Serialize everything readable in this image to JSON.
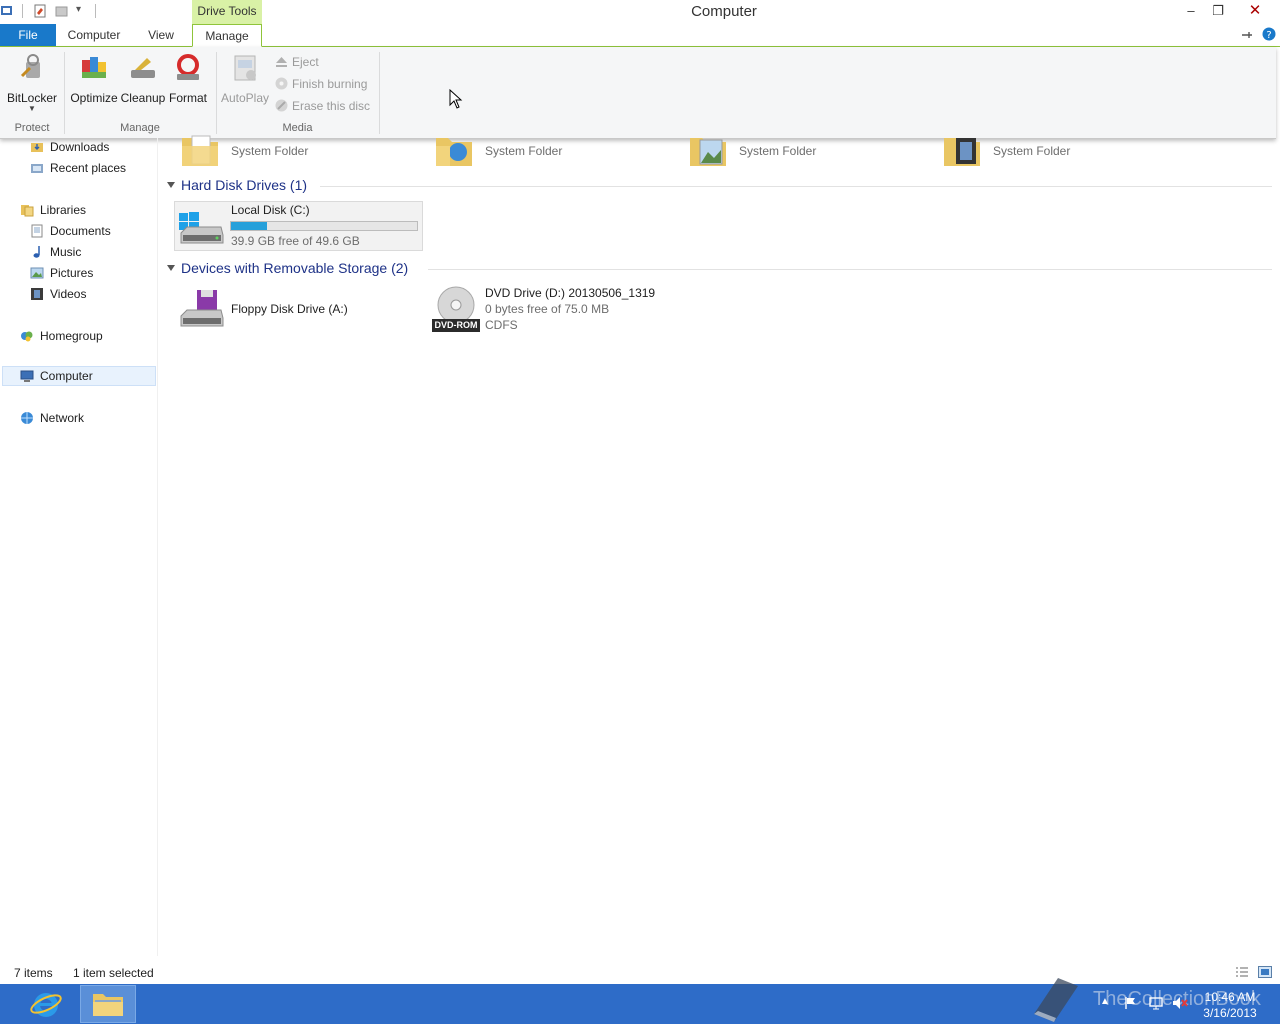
{
  "window": {
    "title": "Computer",
    "context_tab": "Drive Tools",
    "controls": {
      "minimize": "–",
      "restore": "❐",
      "close": "✕"
    }
  },
  "tabs": [
    {
      "label": "File"
    },
    {
      "label": "Computer"
    },
    {
      "label": "View"
    },
    {
      "label": "Manage"
    }
  ],
  "ribbon": {
    "protect": {
      "bitlocker": "BitLocker",
      "label": "Protect"
    },
    "manage": {
      "optimize": "Optimize",
      "cleanup": "Cleanup",
      "format": "Format",
      "label": "Manage"
    },
    "media": {
      "autoplay": "AutoPlay",
      "eject": "Eject",
      "finish_burning": "Finish burning",
      "erase_disc": "Erase this disc",
      "label": "Media"
    }
  },
  "nav": {
    "downloads": "Downloads",
    "recent": "Recent places",
    "libraries": "Libraries",
    "documents": "Documents",
    "music": "Music",
    "pictures": "Pictures",
    "videos": "Videos",
    "homegroup": "Homegroup",
    "computer": "Computer",
    "network": "Network"
  },
  "folders": [
    {
      "sub": "System Folder"
    },
    {
      "sub": "System Folder"
    },
    {
      "sub": "System Folder"
    },
    {
      "sub": "System Folder"
    }
  ],
  "groups": {
    "hdd": "Hard Disk Drives (1)",
    "removable": "Devices with Removable Storage (2)"
  },
  "drives": {
    "c": {
      "name": "Local Disk (C:)",
      "free": "39.9 GB free of 49.6 GB",
      "used_fraction": 0.196
    },
    "a": {
      "name": "Floppy Disk Drive (A:)"
    },
    "d": {
      "name": "DVD Drive (D:) 20130506_1319",
      "free": "0 bytes free of 75.0 MB",
      "fs": "CDFS",
      "badge": "DVD-ROM"
    }
  },
  "status": {
    "items": "7 items",
    "selected": "1 item selected"
  },
  "taskbar": {
    "time": "10:46 AM",
    "date": "3/16/2013",
    "watermark": "TheCollectionBook"
  },
  "colors": {
    "accent": "#1979ca",
    "context": "#d9f1a6",
    "taskbar": "#2e6cc8",
    "bar": "#26a0da"
  }
}
